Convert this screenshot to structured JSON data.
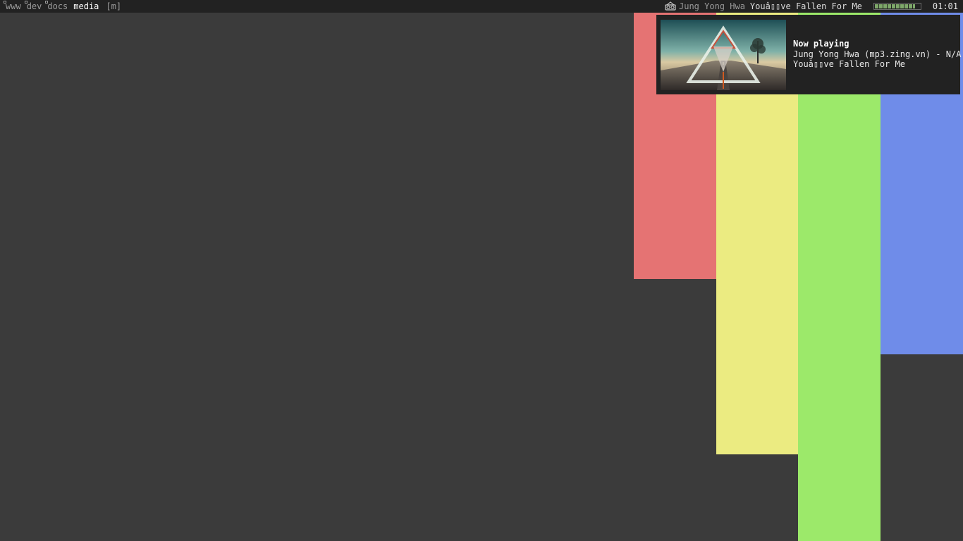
{
  "topbar": {
    "tags": [
      {
        "label": "www",
        "occupied": true,
        "selected": false
      },
      {
        "label": "dev",
        "occupied": true,
        "selected": false
      },
      {
        "label": "docs",
        "occupied": true,
        "selected": false
      },
      {
        "label": "media",
        "occupied": false,
        "selected": true
      }
    ],
    "layout": "[m]",
    "now_playing_artist": "Jung Yong Hwa",
    "now_playing_title": "Youâ▯▯ve Fallen For Me",
    "volume_percent": 90,
    "clock": "01:01"
  },
  "notification": {
    "heading": "Now playing",
    "line1": "Jung Yong Hwa (mp3.zing.vn) - N/A",
    "line2": "Youâ▯▯ve Fallen For Me",
    "album_art_icon": "album-art-triangle-road"
  },
  "colors": {
    "desktop_bg": "#3b3b3b",
    "bar_bg": "#222222",
    "red": "#e57373",
    "yellow": "#ebeb81",
    "green": "#9ce96a",
    "blue": "#6f8ce9"
  }
}
